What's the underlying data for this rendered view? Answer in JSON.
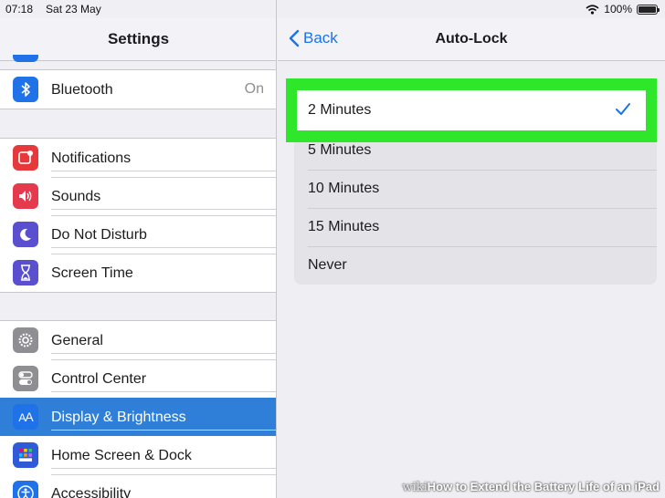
{
  "status": {
    "time": "07:18",
    "date": "Sat 23 May",
    "battery": "100%",
    "battery_level": 1.0
  },
  "sidebar": {
    "title": "Settings",
    "bluetooth": {
      "label": "Bluetooth",
      "value": "On",
      "icon": "bluetooth-icon",
      "color": "#1f72e8"
    },
    "group2": [
      {
        "label": "Notifications",
        "icon": "notifications-icon",
        "color": "#e5393b"
      },
      {
        "label": "Sounds",
        "icon": "sounds-icon",
        "color": "#e5394e"
      },
      {
        "label": "Do Not Disturb",
        "icon": "moon-icon",
        "color": "#5a4fcf"
      },
      {
        "label": "Screen Time",
        "icon": "hourglass-icon",
        "color": "#5a4fcf"
      }
    ],
    "group3": [
      {
        "label": "General",
        "icon": "gear-icon",
        "color": "#8e8e93"
      },
      {
        "label": "Control Center",
        "icon": "toggles-icon",
        "color": "#8e8e93"
      },
      {
        "label": "Display & Brightness",
        "icon": "text-size-icon",
        "color": "#1f72e8",
        "selected": true
      },
      {
        "label": "Home Screen & Dock",
        "icon": "grid-icon",
        "color": "#2f5bd8"
      },
      {
        "label": "Accessibility",
        "icon": "accessibility-icon",
        "color": "#1f72e8"
      }
    ]
  },
  "detail": {
    "back_label": "Back",
    "title": "Auto-Lock",
    "selected_option": "2 Minutes",
    "options": [
      "5 Minutes",
      "10 Minutes",
      "15 Minutes",
      "Never"
    ]
  },
  "watermark": {
    "brand": "wiki",
    "how": "How",
    "text": " to Extend the Battery Life of an iPad"
  },
  "colors": {
    "accent": "#1a73e8",
    "highlight": "#2ee72a",
    "selection": "#2f7fd9"
  }
}
